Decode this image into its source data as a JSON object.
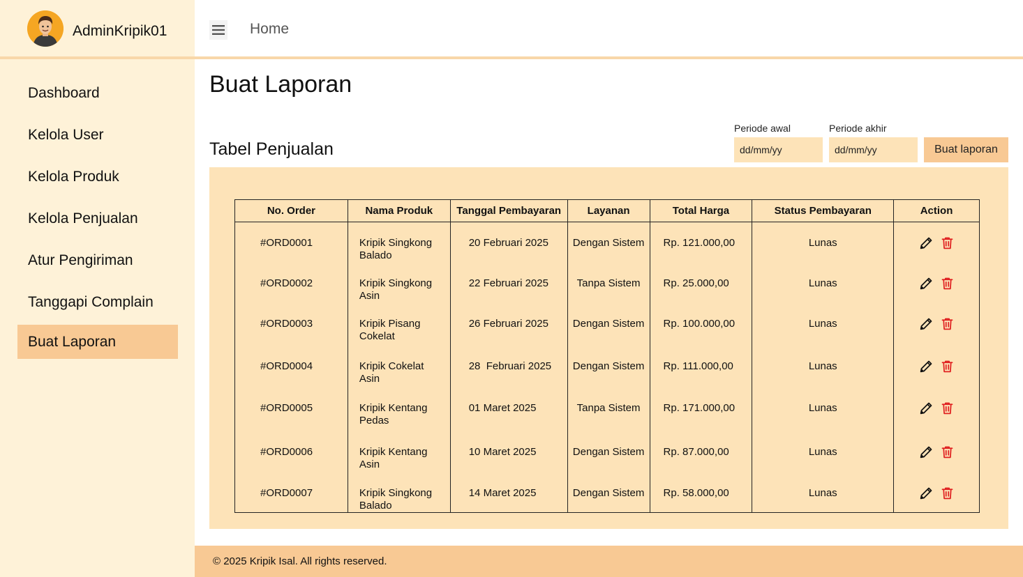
{
  "brand": {
    "name": "AdminKripik01"
  },
  "header": {
    "breadcrumb": "Home",
    "menu_icon": "hamburger-icon"
  },
  "sidebar": {
    "items": [
      {
        "label": "Dashboard",
        "active": false
      },
      {
        "label": "Kelola User",
        "active": false
      },
      {
        "label": "Kelola Produk",
        "active": false
      },
      {
        "label": "Kelola Penjualan",
        "active": false
      },
      {
        "label": "Atur Pengiriman",
        "active": false
      },
      {
        "label": "Tanggapi Complain",
        "active": false
      },
      {
        "label": "Buat Laporan",
        "active": true
      }
    ]
  },
  "main": {
    "title": "Buat Laporan",
    "section_title": "Tabel Penjualan",
    "filters": {
      "start_label": "Periode awal",
      "start_placeholder": "dd/mm/yy",
      "end_label": "Periode akhir",
      "end_placeholder": "dd/mm/yy",
      "button_label": "Buat laporan"
    },
    "table": {
      "headers": [
        "No. Order",
        "Nama Produk",
        "Tanggal Pembayaran",
        "Layanan",
        "Total Harga",
        "Status Pembayaran",
        "Action"
      ],
      "rows": [
        {
          "order": "#ORD0001",
          "product": [
            "Kripik Singkong",
            "Balado"
          ],
          "date": "20 Februari 2025",
          "service": "Dengan Sistem",
          "total": "Rp. 121.000,00",
          "status": "Lunas"
        },
        {
          "order": "#ORD0002",
          "product": [
            "Kripik Singkong",
            "Asin"
          ],
          "date": "22 Februari 2025",
          "service": "Tanpa Sistem",
          "total": "Rp. 25.000,00",
          "status": "Lunas"
        },
        {
          "order": "#ORD0003",
          "product": [
            "Kripik Pisang",
            "Cokelat"
          ],
          "date": "26 Februari 2025",
          "service": "Dengan Sistem",
          "total": "Rp. 100.000,00",
          "status": "Lunas"
        },
        {
          "order": "#ORD0004",
          "product": [
            "Kripik Cokelat",
            "Asin"
          ],
          "date": "28  Februari 2025",
          "service": "Dengan Sistem",
          "total": "Rp. 111.000,00",
          "status": "Lunas"
        },
        {
          "order": "#ORD0005",
          "product": [
            "Kripik Kentang",
            "Pedas"
          ],
          "date": "01 Maret 2025",
          "service": "Tanpa Sistem",
          "total": "Rp. 171.000,00",
          "status": "Lunas"
        },
        {
          "order": "#ORD0006",
          "product": [
            "Kripik Kentang",
            "Asin"
          ],
          "date": "10 Maret 2025",
          "service": "Dengan Sistem",
          "total": "Rp. 87.000,00",
          "status": "Lunas"
        },
        {
          "order": "#ORD0007",
          "product": [
            "Kripik Singkong",
            "Balado"
          ],
          "date": "14 Maret 2025",
          "service": "Dengan Sistem",
          "total": "Rp. 58.000,00",
          "status": "Lunas"
        }
      ],
      "action_icons": [
        "pencil-icon",
        "trash-icon"
      ]
    }
  },
  "footer": {
    "text": "© 2025 Kripik Isal. All rights reserved."
  },
  "colors": {
    "sidebar_bg": "#fef2d8",
    "active_nav": "#f8c994",
    "panel_bg": "#fde3b8",
    "footer_bg": "#f8c994",
    "delete_red": "#e02020"
  }
}
